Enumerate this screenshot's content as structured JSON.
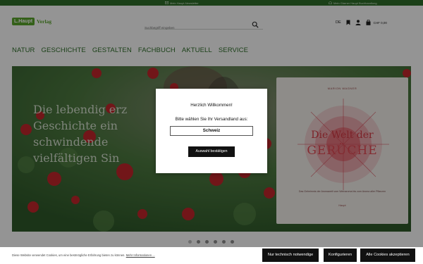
{
  "topbar": {
    "item_a": "Mein Haupt-Newsletter",
    "item_b": "Mein Glarner Haupt Buchhandlung"
  },
  "header": {
    "logo_left": "L.Haupt",
    "logo_right": "Verlag",
    "search_placeholder": "Suchbegriff eingeben",
    "language": "DE",
    "cart_total": "CHF 0,00"
  },
  "nav": {
    "items": [
      "NATUR",
      "GESCHICHTE",
      "GESTALTEN",
      "FACHBUCH",
      "AKTUELL",
      "SERVICE"
    ]
  },
  "hero": {
    "line1": "Die lebendig erz",
    "line2": "Geschichte ein",
    "line3": "schwindende",
    "line4": "vielfältigen Sin",
    "book_author": "MARION WAGNER",
    "book_title_1": "Die Welt der",
    "book_title_2": "GERÜCHE",
    "book_subtitle": "Das Geheimnis der Aromawelt vom Weinaroma bis zum Aroma aller Pflanzen",
    "book_publisher": "Haupt"
  },
  "modal": {
    "title": "Herzlich Willkommen!",
    "label": "Bitte wählen Sie Ihr Versandland aus:",
    "selected_country": "Schweiz",
    "confirm_button": "Auswahl bestätigen"
  },
  "cookie": {
    "text": "Diese Website verwendet Cookies, um eine bestmögliche Erfahrung bieten zu können.",
    "link": "Mehr Informationen ...",
    "btn_necessary": "Nur technisch notwendige",
    "btn_configure": "Konfigurieren",
    "btn_accept": "Alle Cookies akzeptieren"
  },
  "colors": {
    "brand_green": "#2f6f2a",
    "logo_green": "#5aa52c",
    "book_red": "#e34b55"
  },
  "icons": [
    "mail-icon",
    "store-icon",
    "search-icon",
    "bookmark-icon",
    "user-icon",
    "cart-icon"
  ],
  "slider": {
    "count": 6,
    "active_index": 0
  }
}
